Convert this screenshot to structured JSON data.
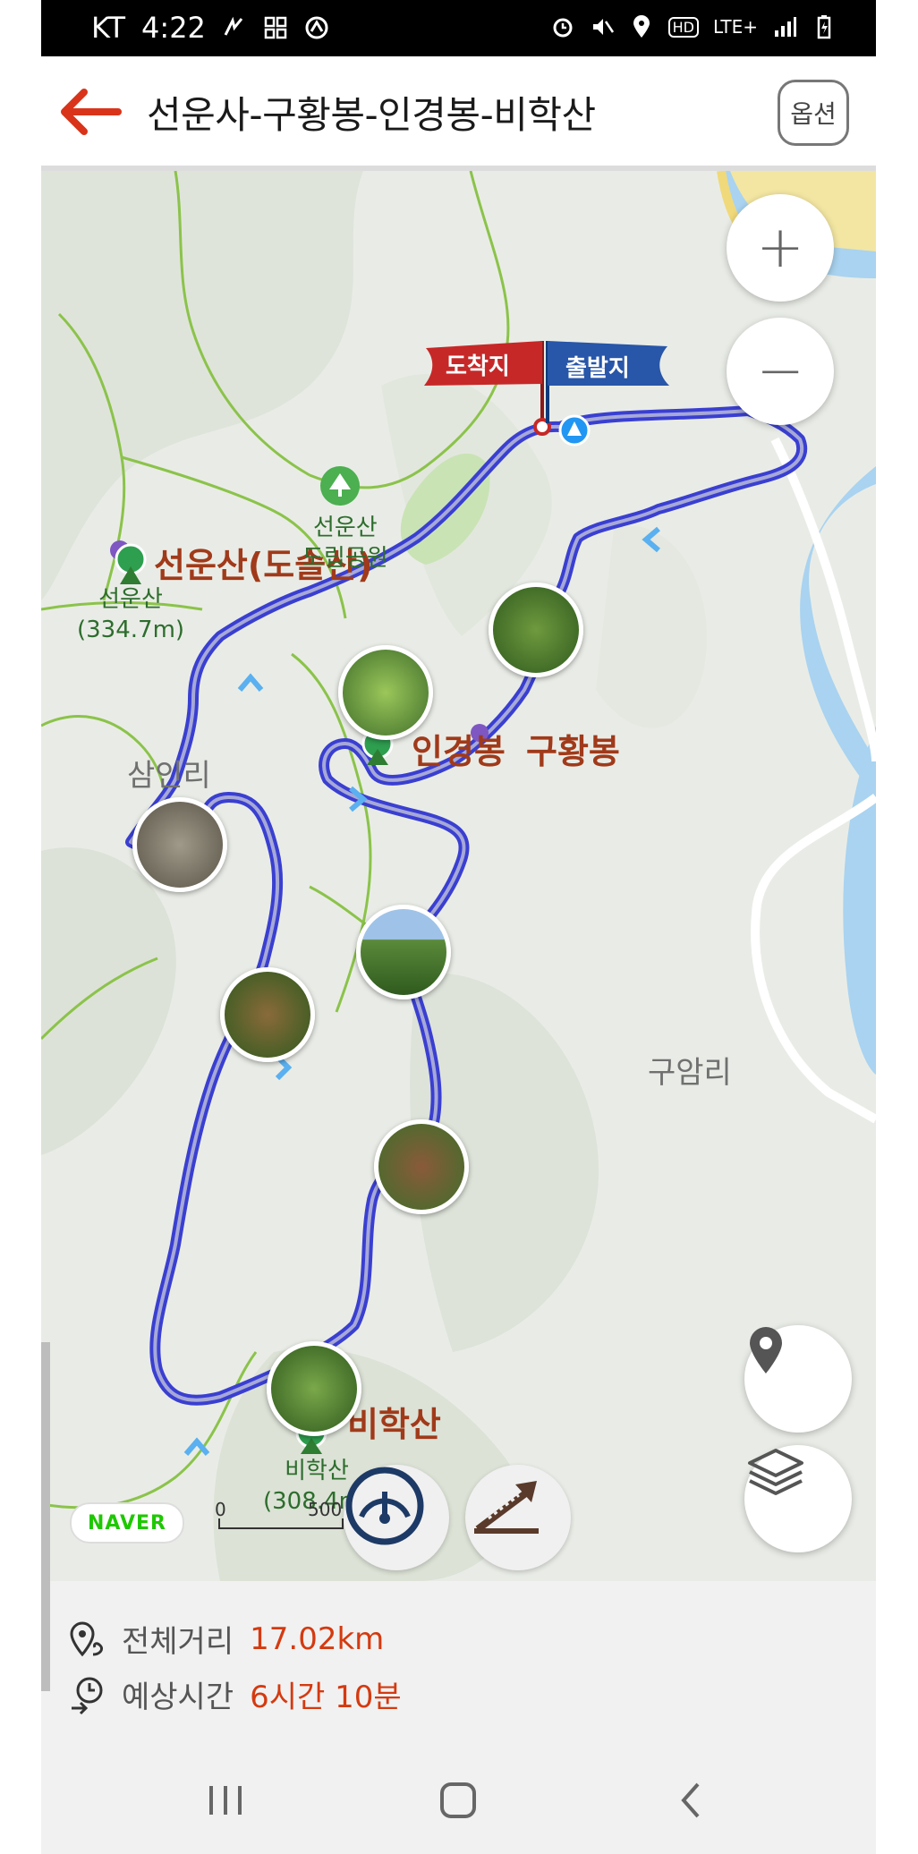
{
  "status_bar": {
    "carrier": "KT",
    "time": "4:22",
    "network": "LTE+"
  },
  "header": {
    "title": "선운사-구황봉-인경봉-비학산",
    "options_label": "옵션"
  },
  "map": {
    "flags": {
      "arrival": "도착지",
      "departure": "출발지"
    },
    "peak_labels": {
      "seonunsan_dosolsan": "선운산(도솔산)",
      "ingyeongbong": "인경봉",
      "guhwangbong": "구황봉",
      "bihaksan": "비학산"
    },
    "place_labels": {
      "saminri": "삼인리",
      "guamri": "구암리",
      "park_line1": "선운산",
      "park_line2": "도립공원"
    },
    "mountain_labels": {
      "seonunsan_name": "선운산",
      "seonunsan_height": "(334.7m)",
      "bihaksan_name": "비학산",
      "bihaksan_height": "(308.4m)"
    },
    "naver_logo": "NAVER",
    "scale": {
      "start": "0",
      "end": "500"
    },
    "zoom_in": "+",
    "zoom_out": "−"
  },
  "summary": {
    "distance_label": "전체거리",
    "distance_value": "17.02km",
    "time_label": "예상시간",
    "time_value": "6시간 10분"
  },
  "colors": {
    "route": "#3a3fd1",
    "accent": "#d43a10",
    "peak": "#a03a1a",
    "back_arrow": "#d9341a"
  }
}
